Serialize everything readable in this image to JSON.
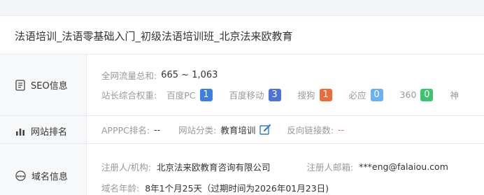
{
  "site_title": "法语培训_法语零基础入门_初级法语培训班_北京法来欧教育",
  "seo": {
    "label": "SEO信息",
    "traffic_label": "全网流量总和:",
    "traffic_value": "665 ~ 1,063",
    "weight_label": "站长综合权重:",
    "weights": [
      {
        "name": "百度PC",
        "value": "1",
        "color": "#3d7ee0"
      },
      {
        "name": "百度移动",
        "value": "3",
        "color": "#4c72d8"
      },
      {
        "name": "搜狗",
        "value": "1",
        "color": "#ec6b3b"
      },
      {
        "name": "必应",
        "value": "0",
        "color": "#69b1f0"
      },
      {
        "name": "360",
        "value": "0",
        "color": "#3cc46f"
      },
      {
        "name": "神",
        "value": "",
        "color": ""
      }
    ]
  },
  "ranking": {
    "label": "网站排名",
    "apppc_label": "APPPC排名:",
    "apppc_value": "--",
    "category_label": "网站分类:",
    "category_value": "教育培训",
    "backlinks_label": "反向链接数:",
    "backlinks_value": "--"
  },
  "domain": {
    "label": "域名信息",
    "registrant_label": "注册人/机构:",
    "registrant_value": "北京法来欧教育咨询有限公司",
    "email_label": "注册人邮箱:",
    "email_value": "***eng@falaiou.com",
    "age_label": "域名年龄:",
    "age_value": "8年1个月25天（过期时间为2026年01月23日)"
  }
}
